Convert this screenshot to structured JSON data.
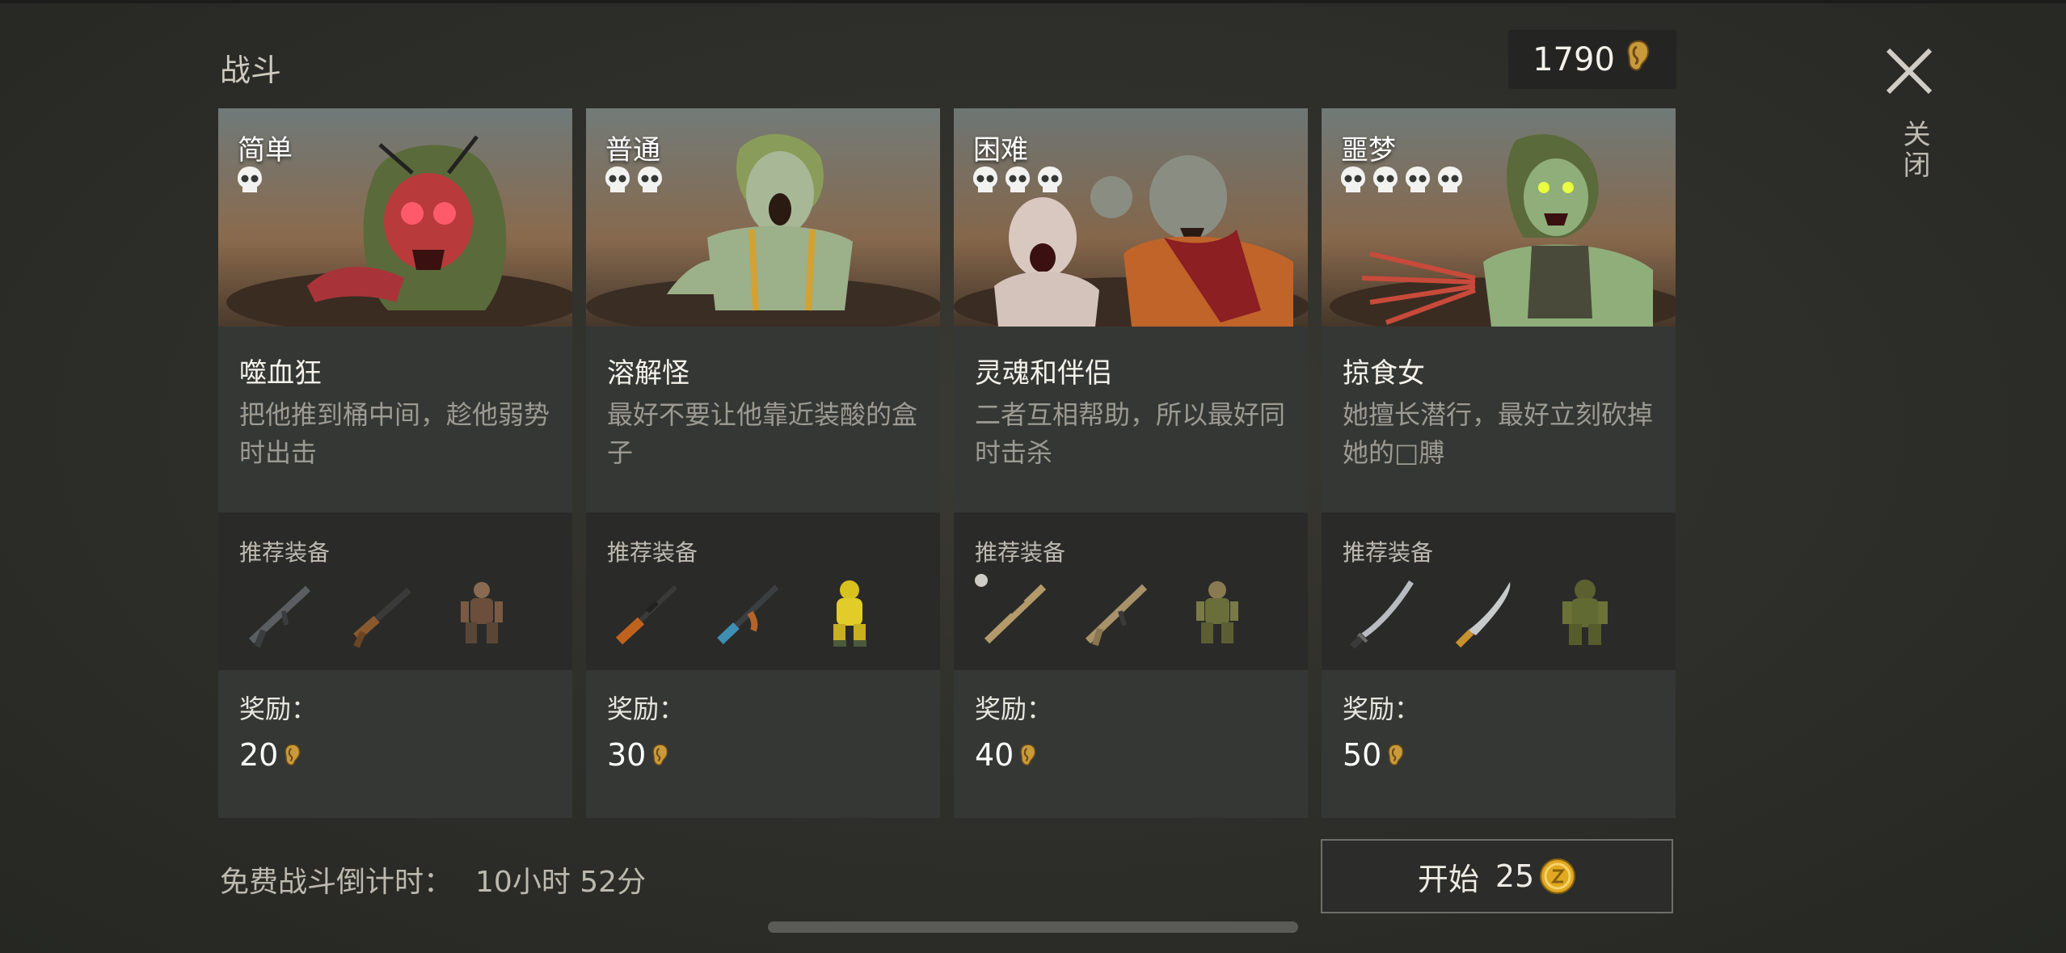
{
  "header": {
    "title": "战斗",
    "currency_amount": "1790",
    "currency_icon": "ear-icon",
    "close_label": "关闭"
  },
  "cards": [
    {
      "difficulty": "简单",
      "skulls": 1,
      "enemy_name": "噬血狂",
      "description": "把他推到桶中间，趁他弱势时出击",
      "equip_label": "推荐装备",
      "equipment": [
        "assault-rifle-icon",
        "shotgun-icon",
        "survivor-armor-icon"
      ],
      "reward_label": "奖励：",
      "reward": "20"
    },
    {
      "difficulty": "普通",
      "skulls": 2,
      "enemy_name": "溶解怪",
      "description": "最好不要让他靠近装酸的盒子",
      "equip_label": "推荐装备",
      "equipment": [
        "hunting-rifle-icon",
        "ak-rifle-icon",
        "hazmat-suit-icon"
      ],
      "reward_label": "奖励：",
      "reward": "30"
    },
    {
      "difficulty": "困难",
      "skulls": 3,
      "enemy_name": "灵魂和伴侣",
      "description": "二者互相帮助，所以最好同时击杀",
      "equip_label": "推荐装备",
      "equipment": [
        "sniper-rifle-icon",
        "scar-rifle-icon",
        "military-armor-icon"
      ],
      "reward_label": "奖励：",
      "reward": "40"
    },
    {
      "difficulty": "噩梦",
      "skulls": 4,
      "enemy_name": "掠食女",
      "description": "她擅长潜行，最好立刻砍掉她的□膊",
      "equip_label": "推荐装备",
      "equipment": [
        "katana-icon",
        "machete-icon",
        "ghillie-suit-icon"
      ],
      "reward_label": "奖励：",
      "reward": "50"
    }
  ],
  "footer": {
    "timer_label": "免费战斗倒计时：",
    "timer_value": "10小时 52分",
    "start_label": "开始",
    "start_cost": "25",
    "start_cost_icon": "gold-coin-icon"
  },
  "colors": {
    "background": "#2f2f2b",
    "card": "#353734",
    "equip_panel": "#2a2b28",
    "ear_gold": "#c99a3a",
    "coin_gold": "#e0a920"
  }
}
